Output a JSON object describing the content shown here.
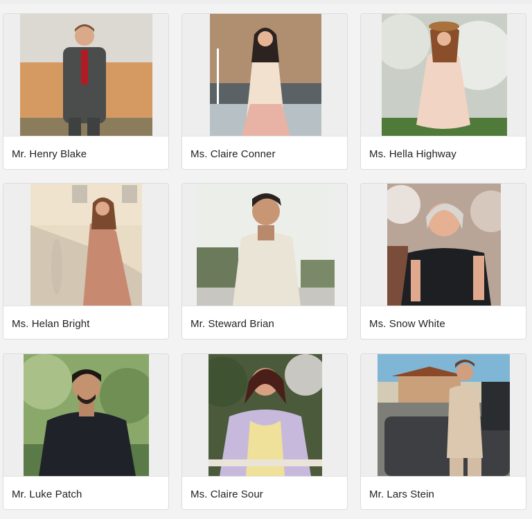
{
  "profiles": [
    {
      "name": "Mr. Henry Blake"
    },
    {
      "name": "Ms. Claire Conner"
    },
    {
      "name": "Ms. Hella Highway"
    },
    {
      "name": "Ms. Helan Bright"
    },
    {
      "name": "Mr. Steward Brian"
    },
    {
      "name": "Ms. Snow White"
    },
    {
      "name": "Mr. Luke Patch"
    },
    {
      "name": "Ms. Claire Sour"
    },
    {
      "name": "Mr. Lars Stein"
    }
  ]
}
